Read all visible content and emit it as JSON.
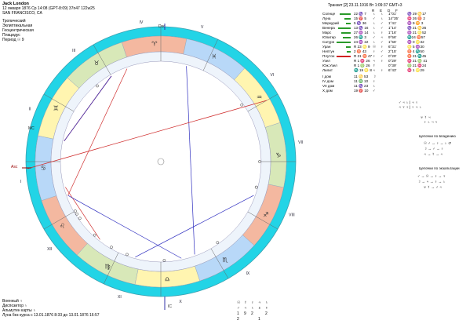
{
  "header": {
    "name": "Jack London",
    "line1": "12 января 1876  Ср  14:08 (GPT-8:09) 37n47  122w25",
    "line2": "SAN FRANCISCO, CA",
    "opts": [
      "Тропический",
      "Эклиптикальная",
      "Геоцентрическая",
      "Плацидус",
      "Период ☉ 9"
    ]
  },
  "transit_header": "Транзит [2] 23.11.1916  Вт  1:09:37 GMT+3",
  "table_headers": [
    "R",
    "E",
    "D",
    "F"
  ],
  "planets": [
    {
      "name": "Солнце",
      "pos": "22 ♑ 7",
      "sym": "♄",
      "r": "♄",
      "e": "1°01'",
      "f": "♑ 29 ♋17",
      "bar": "#2a9a2a",
      "bw": 14
    },
    {
      "name": "Луна",
      "pos": "15 ♈ 5",
      "sym": "♂",
      "r": "♄",
      "e": "14°35'",
      "f": "♓ 26 ♉ 2",
      "bar": "#2a9a2a",
      "bw": 8
    },
    {
      "name": "Меркурий",
      "pos": "5 ♑ 36",
      "sym": "♄",
      "r": "♂",
      "e": "1°41'",
      "f": "♒ 9 ♊ 3",
      "bar": "#2a9a2a",
      "bw": 6
    },
    {
      "name": "Венера",
      "pos": "13 ♑ 16",
      "sym": "♄",
      "r": "♂",
      "e": "1°14'",
      "f": "♑ 21 ♋26",
      "bar": "#2a9a2a",
      "bw": 16
    },
    {
      "name": "Марс",
      "pos": "27 ♒ 14",
      "sym": "♄",
      "r": "♀",
      "e": "1°16'",
      "f": "♒ 21 ♌52",
      "bar": "#2a9a2a",
      "bw": 12
    },
    {
      "name": "Юпитер",
      "pos": "26 ♏ 3",
      "sym": "♂",
      "r": "♃",
      "e": "9°56'",
      "f": "♏24 ♉57",
      "bar": "#2a9a2a",
      "bw": 10
    },
    {
      "name": "Сатурн",
      "pos": "24 ♒ 22",
      "sym": "♄",
      "r": "♂",
      "e": "1°56'",
      "f": "♒ 0 ♌32",
      "bar": "#2a9a2a",
      "bw": 18
    },
    {
      "name": "Уран",
      "pos": "R 23 ♌ 9",
      "sym": "☉",
      "r": "♀",
      "e": "6°31'",
      "f": "♌ 5 ♒30",
      "bar": "#2a9a2a",
      "bw": 6
    },
    {
      "name": "Нептун",
      "pos": "2 ♉ 43",
      "sym": "♀",
      "r": "♂",
      "e": "2°15'",
      "f": "♉ 4 ♏50",
      "bar": "#2a9a2a",
      "bw": 5
    },
    {
      "name": "Плутон",
      "pos": "R 21 ♉ 47",
      "sym": "♀",
      "r": "♂",
      "e": "0°29'",
      "f": "♉ 21 ♏45",
      "bar": "#d02020",
      "bw": 18
    },
    {
      "name": "Узел",
      "pos": "R 1 ♓ 26",
      "sym": "♃",
      "r": "♀",
      "e": "0°29'",
      "f": "♓ 21 ♍ 41",
      "bar": "",
      "bw": 0
    },
    {
      "name": "Юж.Узел",
      "pos": "R 1 ♍ 26",
      "sym": "☿",
      "r": "",
      "e": "0°39'",
      "f": "♍ 21 ♓24",
      "bar": "",
      "bw": 0
    },
    {
      "name": "Лилит",
      "pos": "♏ 19 ♌ 8",
      "sym": "♃",
      "r": "♀",
      "e": "6°43'",
      "f": "♓ 1 ♌29",
      "bar": "",
      "bw": 0
    },
    {
      "name": "I дом",
      "pos": "11 ♋ 53",
      "sym": "☽",
      "r": "",
      "e": "",
      "f": "",
      "bar": "",
      "bw": 0
    },
    {
      "name": "IV дом",
      "pos": "11 ♎ 10",
      "sym": "♀",
      "r": "",
      "e": "",
      "f": "",
      "bar": "",
      "bw": 0
    },
    {
      "name": "VII дом",
      "pos": "11 ♑ 23",
      "sym": "♄",
      "r": "",
      "e": "",
      "f": "",
      "bar": "",
      "bw": 0
    },
    {
      "name": "X дом",
      "pos": "19 ♈ 10",
      "sym": "♂",
      "r": "",
      "e": "",
      "f": "",
      "bar": "",
      "bw": 0
    }
  ],
  "aspect_grid": {
    "rows": [
      "♂ ♃ ♄ | ♃ ♀",
      "♃ ♆ ♀ | ♀ ♃ ♄",
      "♅ ☿ ♃",
      "♀ ♄ ♃ ♃"
    ]
  },
  "chains": {
    "owner_title": "Цепочки по владению",
    "owner_rows": [
      "☉ ♂ → ♀ → ♄ ↺",
      "☽ → ♂ → ♀",
      "♃ → ☿ → ♃"
    ],
    "exalt_title": "Цепочки по экзальтации",
    "exalt_rows": [
      "♂ → ☉ → ♀ → ♆",
      "☽ → ♃ → ♀ → ♄",
      "♅ ☿ → ♂ ♃"
    ]
  },
  "bottom_left": {
    "lines": [
      "Военный ♀",
      "Диспозитор ♄",
      "Альмутен карты ♄",
      "Луна без курса с 13.01.1876  8:33 до 13.01.1876 16:57"
    ]
  },
  "bottom_center": {
    "row1": [
      "☉",
      "☿",
      "♀",
      "♃",
      "♄"
    ],
    "row2": [
      "♂",
      "♃",
      "♄",
      "♅",
      "♆"
    ],
    "counts1": [
      "1",
      "9",
      "2",
      "",
      "2"
    ],
    "counts2": [
      "2",
      "",
      "",
      "1",
      ""
    ]
  },
  "houses": [
    "I",
    "II",
    "III",
    "IV",
    "V",
    "VI",
    "VII",
    "VIII",
    "IX",
    "X",
    "XI",
    "XII"
  ],
  "angle_labels": {
    "asc": "Asc",
    "mc": "MC",
    "dsc": "Dsc",
    "ic": "IC"
  },
  "signs": [
    "♈",
    "♉",
    "♊",
    "♋",
    "♌",
    "♍",
    "♎",
    "♏",
    "♐",
    "♑",
    "♒",
    "♓"
  ],
  "colors": {
    "zodiac_outer": "#22d4e6",
    "fire": "#f4b8a0",
    "earth": "#d8e8b8",
    "air": "#fff5b0",
    "water": "#b8d8f8",
    "aspect_red": "#d03030",
    "aspect_blue": "#3030c0"
  }
}
